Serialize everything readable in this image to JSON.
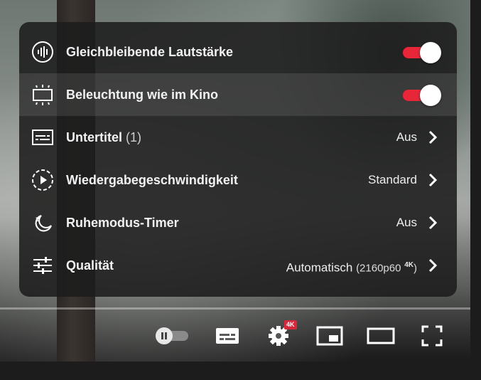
{
  "menu": {
    "items": [
      {
        "icon": "stable-volume-icon",
        "label": "Gleichbleibende Lautstärke",
        "toggle": true
      },
      {
        "icon": "ambient-mode-icon",
        "label": "Beleuchtung wie im Kino",
        "toggle": true
      },
      {
        "icon": "subtitles-icon",
        "label": "Untertitel",
        "count": "(1)",
        "value": "Aus"
      },
      {
        "icon": "playback-speed-icon",
        "label": "Wiedergabegeschwindigkeit",
        "value": "Standard"
      },
      {
        "icon": "sleep-timer-icon",
        "label": "Ruhemodus-Timer",
        "value": "Aus"
      },
      {
        "icon": "quality-icon",
        "label": "Qualität",
        "value": "Automatisch",
        "value_sub": "(2160p60",
        "value_sup": "4K",
        "value_close": ")"
      }
    ]
  },
  "controls": {
    "quality_badge": "4K",
    "items": [
      "autoplay-toggle",
      "subtitles-icon",
      "settings-icon",
      "miniplayer-icon",
      "theater-mode-icon",
      "fullscreen-icon"
    ]
  },
  "colors": {
    "accent": "#e8263a",
    "menu_bg": "#1c1c1c",
    "text": "#f1f1f1"
  }
}
